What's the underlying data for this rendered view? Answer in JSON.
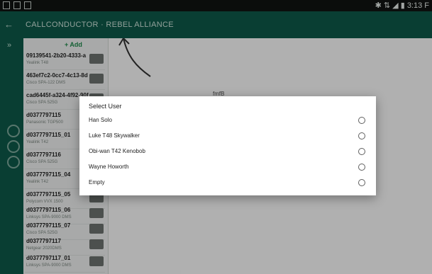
{
  "statusbar": {
    "time": "3:13 F"
  },
  "appbar": {
    "title": "CALLCONDUCTOR  ·  REBEL ALLIANCE"
  },
  "list": {
    "add_label": "+ Add",
    "items": [
      {
        "id": "09139541-2b20-4333-a",
        "model": "Yealink T48"
      },
      {
        "id": "463ef7c2-0cc7-4c13-8d",
        "model": "Cisco SPA-122 DMS"
      },
      {
        "id": "cad6445f-a324-4f92-90f",
        "model": "Cisco SPA 525G"
      },
      {
        "id": "d0377797115",
        "model": "Panasonic TGP500"
      },
      {
        "id": "d0377797115_01",
        "model": "Yealink T42"
      },
      {
        "id": "d0377797116",
        "model": "Cisco SPA 525G"
      },
      {
        "id": "d0377797115_04",
        "model": "Yealink T42"
      },
      {
        "id": "d0377797115_05",
        "model": "Polycom VVX 1500"
      },
      {
        "id": "d0377797115_06",
        "model": "Linksys SPA-9000 DMS"
      },
      {
        "id": "d0377797115_07",
        "model": "Cisco SPA 525G"
      },
      {
        "id": "d0377797117",
        "model": "Netgear 2020DMS"
      },
      {
        "id": "d0377797117_01",
        "model": "Linksys SPA-9000 DMS"
      }
    ]
  },
  "canvas": {
    "text": "fmfB"
  },
  "dialog": {
    "title": "Select User",
    "options": [
      {
        "label": "Han Solo"
      },
      {
        "label": "Luke T48 Skywalker"
      },
      {
        "label": "Obi-wan T42 Kenobob"
      },
      {
        "label": "Wayne Howorth"
      },
      {
        "label": "Empty"
      }
    ]
  }
}
